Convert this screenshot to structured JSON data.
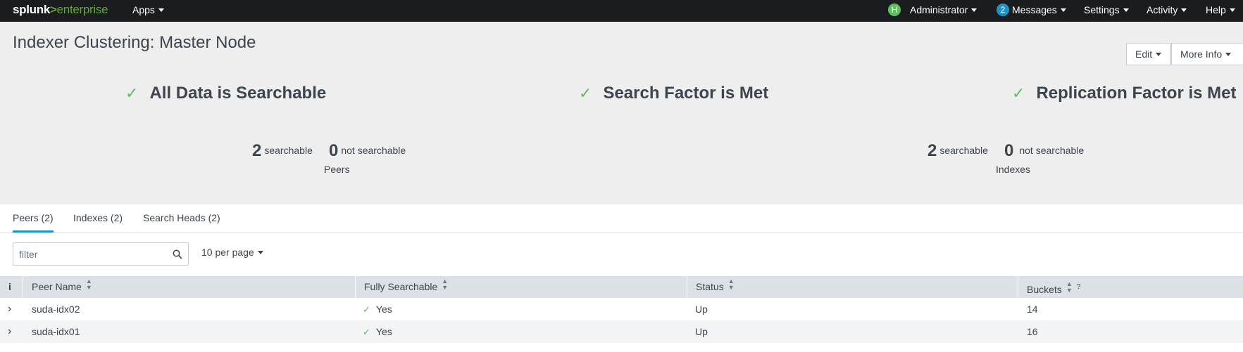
{
  "nav": {
    "brand_splunk": "splunk",
    "brand_gt": ">",
    "brand_enterprise": "enterprise",
    "apps": "Apps",
    "user_initial": "H",
    "user": "Administrator",
    "messages_count": "2",
    "messages": "Messages",
    "settings": "Settings",
    "activity": "Activity",
    "help": "Help"
  },
  "header": {
    "title": "Indexer Clustering: Master Node",
    "edit_label": "Edit",
    "more_info_label": "More Info"
  },
  "status": {
    "items": [
      {
        "text": "All Data is Searchable",
        "icon": "check-icon"
      },
      {
        "text": "Search Factor is Met",
        "icon": "check-icon"
      },
      {
        "text": "Replication Factor is Met",
        "icon": "check-icon"
      }
    ]
  },
  "stats": {
    "peers": {
      "searchable": "2",
      "searchable_label": "searchable",
      "not_searchable": "0",
      "not_searchable_label": "not searchable",
      "caption": "Peers"
    },
    "indexes": {
      "searchable": "2",
      "searchable_label": "searchable",
      "not_searchable": "0",
      "not_searchable_label": "not searchable",
      "caption": "Indexes"
    }
  },
  "tabs": [
    {
      "label": "Peers (2)",
      "active": true
    },
    {
      "label": "Indexes (2)",
      "active": false
    },
    {
      "label": "Search Heads (2)",
      "active": false
    }
  ],
  "filter": {
    "placeholder": "filter",
    "value": ""
  },
  "per_page": "10 per page",
  "table": {
    "info_header": "i",
    "columns": [
      "Peer Name",
      "Fully Searchable",
      "Status",
      "Buckets"
    ],
    "buckets_help": "?",
    "rows": [
      {
        "expander": "›",
        "peer": "suda-idx02",
        "searchable": "Yes",
        "status": "Up",
        "buckets": "14"
      },
      {
        "expander": "›",
        "peer": "suda-idx01",
        "searchable": "Yes",
        "status": "Up",
        "buckets": "16"
      }
    ]
  },
  "colors": {
    "topbar": "#1a1c20",
    "brand_green": "#65a637",
    "check_green": "#5cc05c",
    "accent_blue": "#1e93c6",
    "header_bg": "#eeeeee",
    "table_header_bg": "#dce1e6"
  }
}
